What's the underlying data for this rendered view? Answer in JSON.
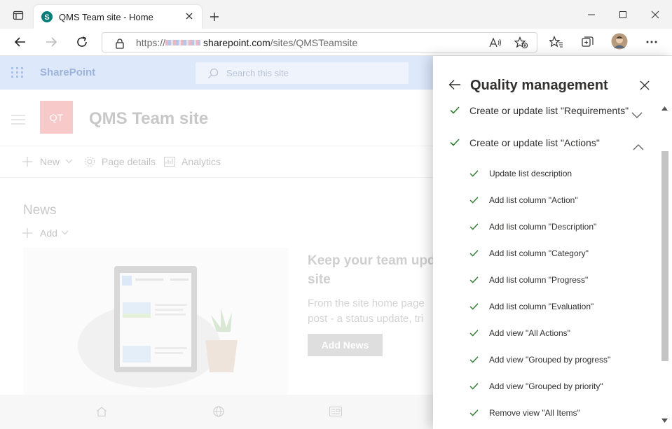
{
  "browser": {
    "tab_title": "QMS Team site - Home",
    "url_prefix": "https://",
    "url_domain": "sharepoint.com",
    "url_path": "/sites/QMSTeamsite"
  },
  "suite": {
    "brand": "SharePoint",
    "search_placeholder": "Search this site"
  },
  "site": {
    "logo_initials": "QT",
    "title": "QMS Team site",
    "commands": {
      "new": "New",
      "page_details": "Page details",
      "analytics": "Analytics"
    },
    "news_heading": "News",
    "add_label": "Add",
    "promo_heading_1": "Keep your team upd",
    "promo_heading_2": "site",
    "promo_body_1": "From the site home page",
    "promo_body_2": "post - a status update, tri",
    "add_news_button": "Add News"
  },
  "panel": {
    "title": "Quality management",
    "steps": [
      {
        "label": "Create or update list \"Requirements\"",
        "expanded": false
      },
      {
        "label": "Create or update list \"Actions\"",
        "expanded": true
      }
    ],
    "substeps": [
      "Update list description",
      "Add list column \"Action\"",
      "Add list column \"Description\"",
      "Add list column \"Category\"",
      "Add list column \"Progress\"",
      "Add list column \"Evaluation\"",
      "Add view \"All Actions\"",
      "Add view \"Grouped by progress\"",
      "Add view \"Grouped by priority\"",
      "Remove view \"All Items\""
    ]
  },
  "colors": {
    "check_green": "#2e7d32",
    "suite_bg": "#dde9fb",
    "logo_bg": "#f4c0c0"
  }
}
